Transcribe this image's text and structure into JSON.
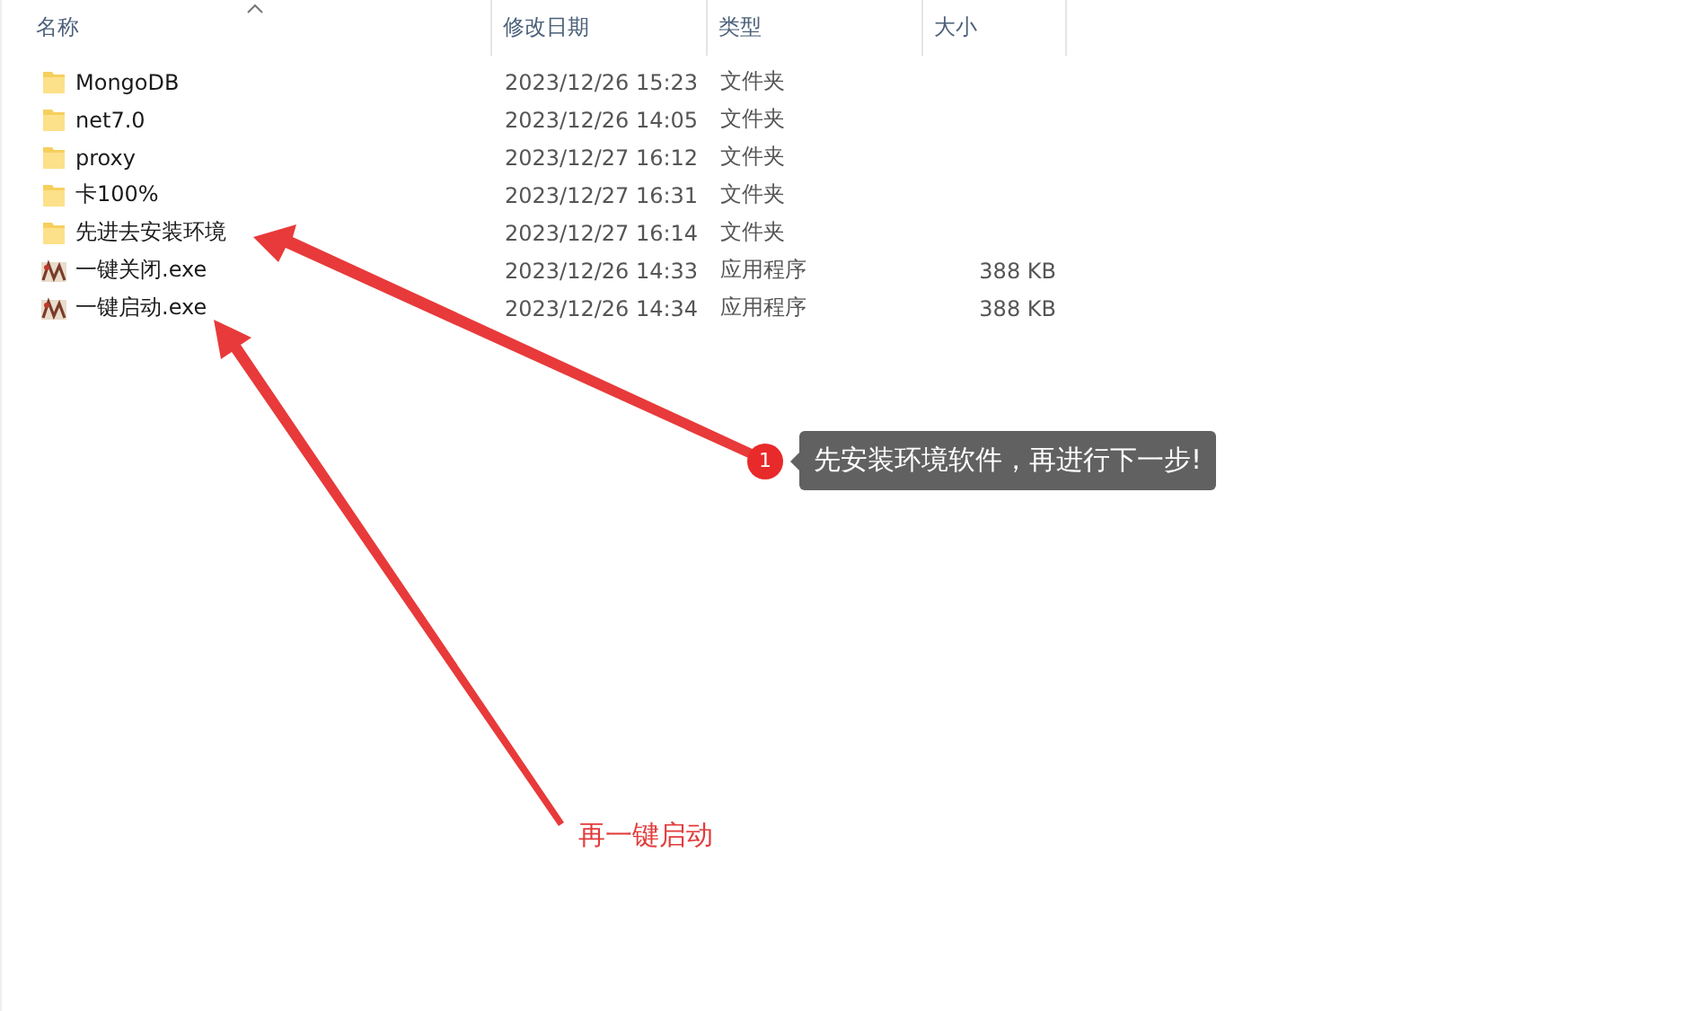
{
  "table": {
    "columns": [
      {
        "label": "名称",
        "sorted": true
      },
      {
        "label": "修改日期",
        "sorted": false
      },
      {
        "label": "类型",
        "sorted": false
      },
      {
        "label": "大小",
        "sorted": false
      }
    ],
    "rows": [
      {
        "kind": "folder",
        "name": "MongoDB",
        "date": "2023/12/26 15:23",
        "type": "文件夹"
      },
      {
        "kind": "folder",
        "name": "net7.0",
        "date": "2023/12/26 14:05",
        "type": "文件夹"
      },
      {
        "kind": "folder",
        "name": "proxy",
        "date": "2023/12/27 16:12",
        "type": "文件夹"
      },
      {
        "kind": "folder",
        "name": "卡100%",
        "date": "2023/12/27 16:31",
        "type": "文件夹"
      },
      {
        "kind": "folder",
        "name": "先进去安装环境",
        "date": "2023/12/27 16:14",
        "type": "文件夹"
      },
      {
        "kind": "exe",
        "name": "一键关闭.exe",
        "date": "2023/12/26 14:33",
        "type": "应用程序",
        "size": "388 KB"
      },
      {
        "kind": "exe",
        "name": "一键启动.exe",
        "date": "2023/12/26 14:34",
        "type": "应用程序",
        "size": "388 KB"
      }
    ]
  },
  "annotations": [
    {
      "kind": "callout",
      "badge": "1",
      "text": "先安装环境软件，再进行下一步!"
    },
    {
      "kind": "label",
      "text": "再一键启动"
    }
  ]
}
